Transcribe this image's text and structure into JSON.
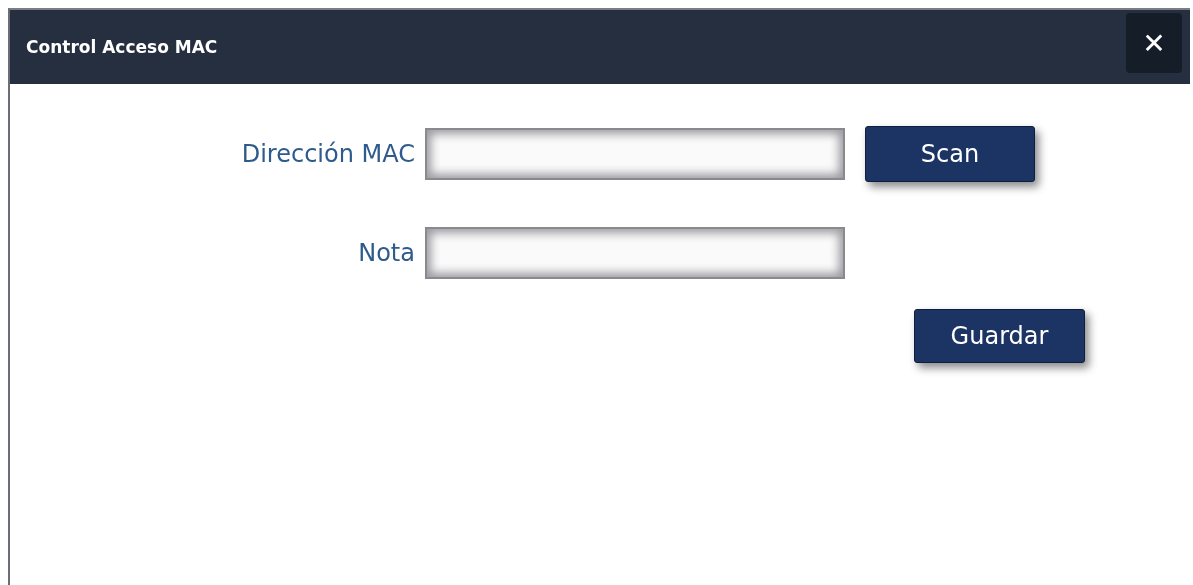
{
  "window": {
    "title": "Control Acceso MAC",
    "close": "✕"
  },
  "fields": [
    {
      "label": "Dirección MAC",
      "button": "Scan"
    },
    {
      "label": "Nota"
    }
  ],
  "buttons": [
    "Guardar"
  ]
}
